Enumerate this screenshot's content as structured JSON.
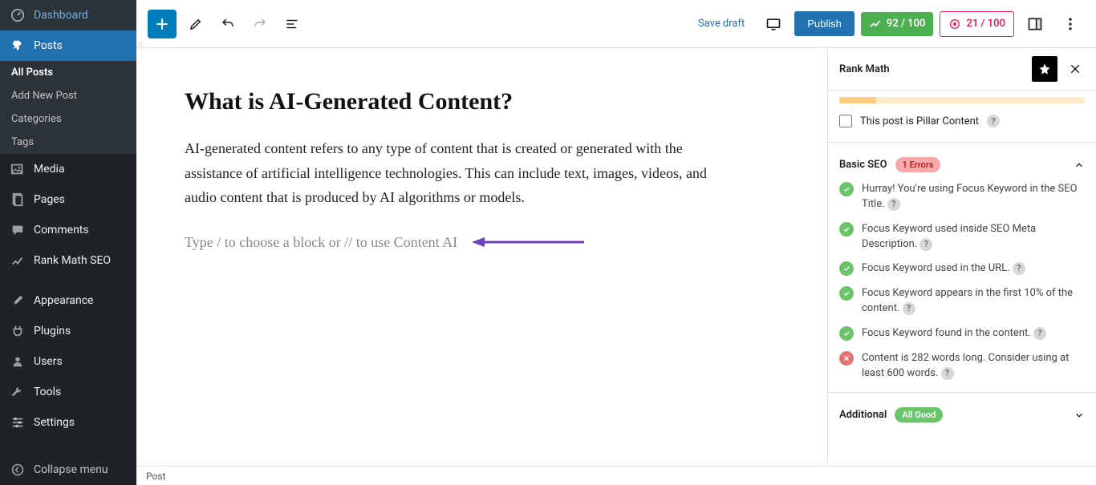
{
  "sidebar": {
    "items": [
      {
        "label": "Dashboard"
      },
      {
        "label": "Posts"
      },
      {
        "label": "Media"
      },
      {
        "label": "Pages"
      },
      {
        "label": "Comments"
      },
      {
        "label": "Rank Math SEO"
      },
      {
        "label": "Appearance"
      },
      {
        "label": "Plugins"
      },
      {
        "label": "Users"
      },
      {
        "label": "Tools"
      },
      {
        "label": "Settings"
      }
    ],
    "posts_sub": [
      {
        "label": "All Posts"
      },
      {
        "label": "Add New Post"
      },
      {
        "label": "Categories"
      },
      {
        "label": "Tags"
      }
    ],
    "collapse": "Collapse menu"
  },
  "topbar": {
    "save_draft": "Save draft",
    "publish": "Publish",
    "score_seo": "92 / 100",
    "score_ai": "21 / 100"
  },
  "post": {
    "title": "What is AI-Generated Content?",
    "body": "AI-generated content refers to any type of content that is created or generated with the assistance of artificial intelligence technologies. This can include text, images, videos, and audio content that is produced by AI algorithms or models.",
    "placeholder": "Type / to choose a block or // to use Content AI"
  },
  "breadcrumb": "Post",
  "rankmath": {
    "title": "Rank Math",
    "pillar_label": "This post is Pillar Content",
    "sections": {
      "basic": {
        "label": "Basic SEO",
        "chip": "1 Errors"
      },
      "additional": {
        "label": "Additional",
        "chip": "All Good"
      }
    },
    "checks": [
      {
        "status": "ok",
        "text": "Hurray! You're using Focus Keyword in the SEO Title."
      },
      {
        "status": "ok",
        "text": "Focus Keyword used inside SEO Meta Description."
      },
      {
        "status": "ok",
        "text": "Focus Keyword used in the URL."
      },
      {
        "status": "ok",
        "text": "Focus Keyword appears in the first 10% of the content."
      },
      {
        "status": "ok",
        "text": "Focus Keyword found in the content."
      },
      {
        "status": "bad",
        "text": "Content is 282 words long. Consider using at least 600 words."
      }
    ]
  }
}
